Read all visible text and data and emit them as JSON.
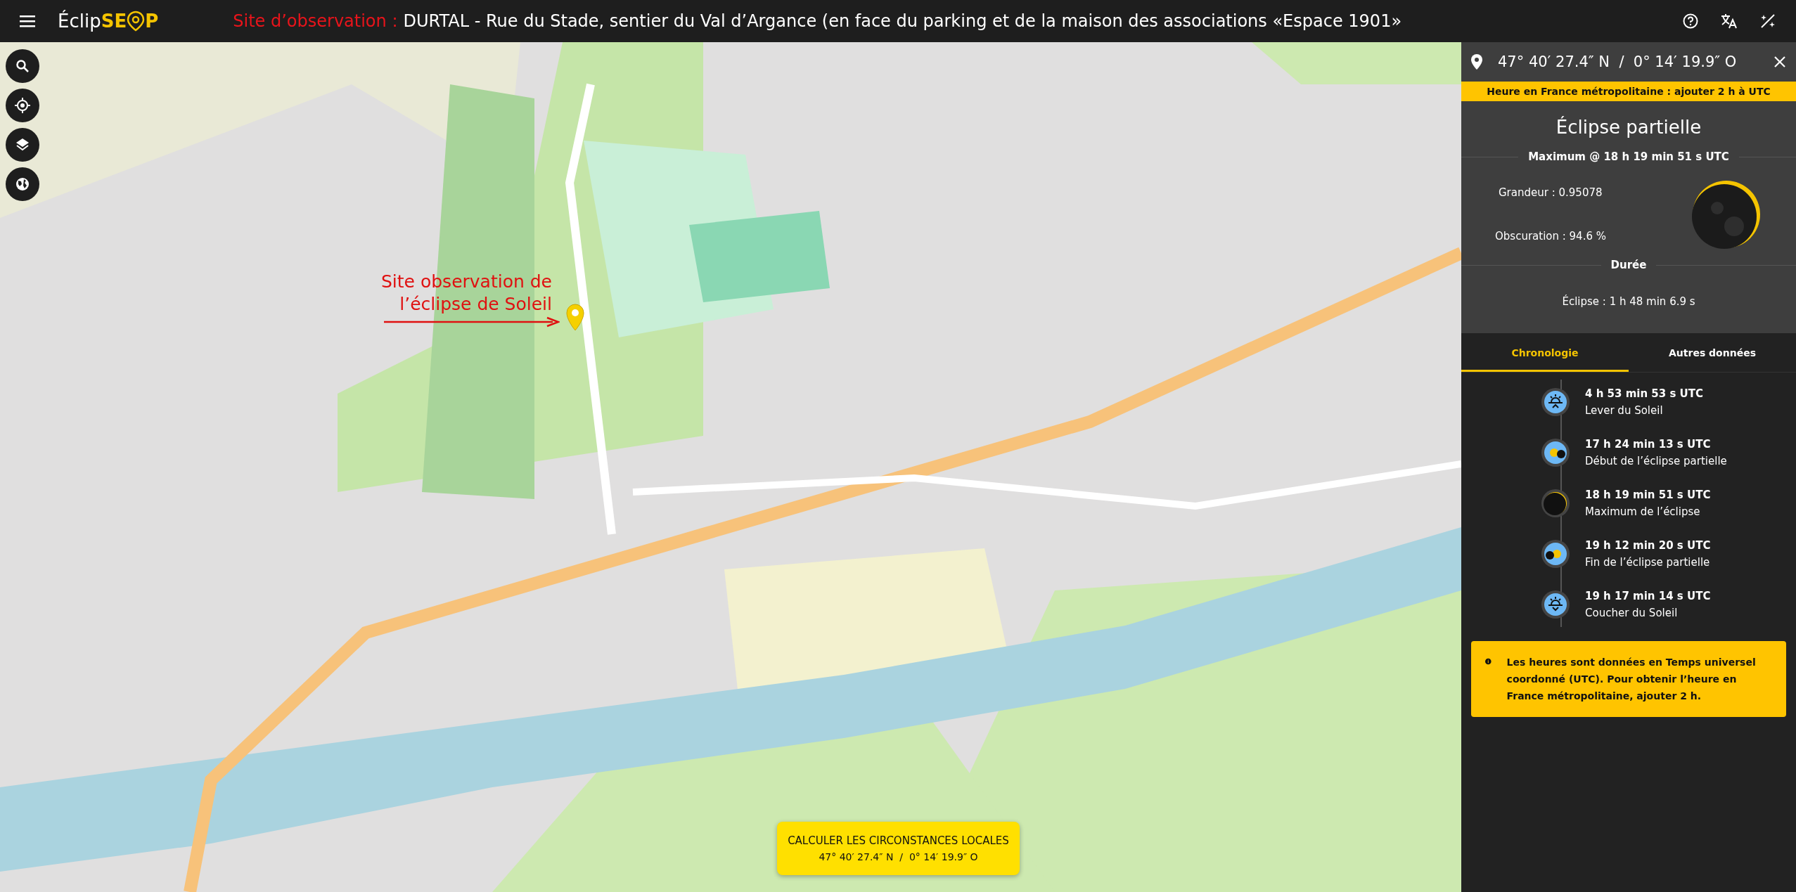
{
  "header": {
    "logo_left": "Éclip",
    "logo_right": "SE",
    "logo_end": "P",
    "site_label": "Site d’observation :",
    "site_text": "DURTAL - Rue du Stade, sentier du Val d’Argance (en face du parking et de la maison des associations «Espace 1901»"
  },
  "map_annotation": {
    "text": "Site observation de l’éclipse de Soleil"
  },
  "calculate_button": {
    "label": "CALCULER LES CIRCONSTANCES LOCALES",
    "coordinates": "47° 40′ 27.4″ N  /  0° 14′ 19.9″ O"
  },
  "panel": {
    "coordinates": "47° 40′ 27.4″ N  /  0° 14′ 19.9″ O",
    "notice": "Heure en France métropolitaine : ajouter 2 h à UTC",
    "title": "Éclipse partielle",
    "maximum": "Maximum @ 18 h 19 min 51 s UTC",
    "magnitude": "Grandeur : 0.95078",
    "obscuration": "Obscuration : 94.6 %",
    "duration_heading": "Durée",
    "duration": "Éclipse : 1 h 48 min 6.9 s",
    "tabs": [
      {
        "label": "Chronologie",
        "selected": true
      },
      {
        "label": "Autres données",
        "selected": false
      }
    ],
    "timeline": [
      {
        "kind": "sunrise",
        "time": "4 h 53 min 53 s UTC",
        "label": "Lever du Soleil"
      },
      {
        "kind": "eclipse_start",
        "time": "17 h 24 min 13 s UTC",
        "label": "Début de l’éclipse partielle"
      },
      {
        "kind": "maximum",
        "time": "18 h 19 min 51 s UTC",
        "label": "Maximum de l’éclipse"
      },
      {
        "kind": "eclipse_end",
        "time": "19 h 12 min 20 s UTC",
        "label": "Fin de l’éclipse partielle"
      },
      {
        "kind": "sunset",
        "time": "19 h 17 min 14 s UTC",
        "label": "Coucher du Soleil"
      }
    ],
    "info": "Les heures sont données en Temps universel coordonné (UTC). Pour obtenir l’heure en France métropolitaine, ajouter 2 h."
  }
}
